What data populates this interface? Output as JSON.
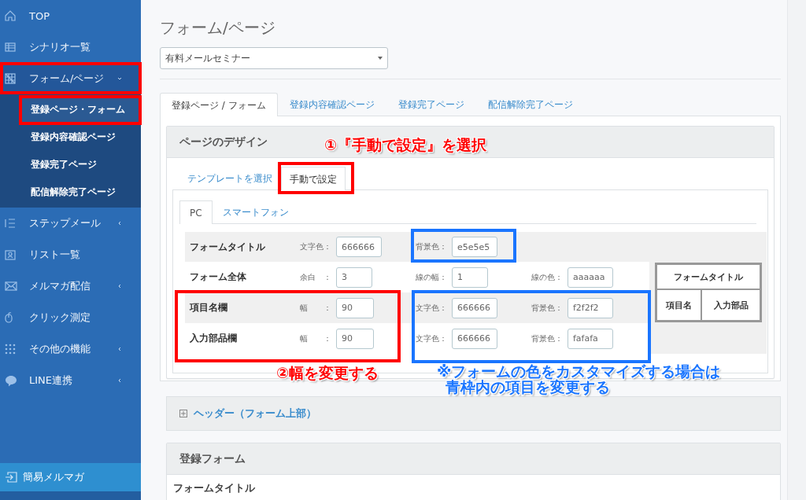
{
  "sidebar": {
    "items": [
      {
        "label": "TOP",
        "kind": "link"
      },
      {
        "label": "シナリオ一覧",
        "kind": "link"
      },
      {
        "label": "フォーム/ページ",
        "kind": "group",
        "expanded": true,
        "children": [
          {
            "label": "登録ページ・フォーム",
            "selected": true
          },
          {
            "label": "登録内容確認ページ",
            "selected": false
          },
          {
            "label": "登録完了ページ",
            "selected": false
          },
          {
            "label": "配信解除完了ページ",
            "selected": false
          }
        ]
      },
      {
        "label": "ステップメール",
        "kind": "group",
        "expanded": false
      },
      {
        "label": "リスト一覧",
        "kind": "link"
      },
      {
        "label": "メルマガ配信",
        "kind": "group",
        "expanded": false
      },
      {
        "label": "クリック測定",
        "kind": "link"
      },
      {
        "label": "その他の機能",
        "kind": "group",
        "expanded": false
      },
      {
        "label": "LINE連携",
        "kind": "group",
        "expanded": false
      }
    ],
    "footer_item": "簡易メルマガ"
  },
  "main": {
    "title": "フォーム/ページ",
    "select": {
      "value": "有料メールセミナー"
    },
    "tabs": [
      {
        "label": "登録ページ / フォーム",
        "selected": true
      },
      {
        "label": "登録内容確認ページ",
        "selected": false
      },
      {
        "label": "登録完了ページ",
        "selected": false
      },
      {
        "label": "配信解除完了ページ",
        "selected": false
      }
    ],
    "design_panel": {
      "title": "ページのデザイン",
      "mode_tabs": [
        {
          "label": "テンプレートを選択",
          "selected": false
        },
        {
          "label": "手動で設定",
          "selected": true
        }
      ],
      "device_tabs": [
        {
          "label": "PC",
          "selected": true
        },
        {
          "label": "スマートフォン",
          "selected": false
        }
      ],
      "rows": [
        {
          "label": "フォームタイトル",
          "fields": [
            {
              "label": "文字色：",
              "value": "666666"
            },
            {
              "label": "背景色：",
              "value": "e5e5e5"
            }
          ]
        },
        {
          "label": "フォーム全体",
          "fields": [
            {
              "label": "余白　：",
              "value": "3"
            },
            {
              "label": "線の幅：",
              "value": "1"
            },
            {
              "label": "線の色：",
              "value": "aaaaaa"
            }
          ]
        },
        {
          "label": "項目名欄",
          "fields": [
            {
              "label": "幅　　：",
              "value": "90"
            },
            {
              "label": "文字色：",
              "value": "666666"
            },
            {
              "label": "背景色：",
              "value": "f2f2f2"
            }
          ]
        },
        {
          "label": "入力部品欄",
          "fields": [
            {
              "label": "幅　　：",
              "value": "90"
            },
            {
              "label": "文字色：",
              "value": "666666"
            },
            {
              "label": "背景色：",
              "value": "fafafa"
            }
          ]
        }
      ],
      "preview": {
        "title_cell": "フォームタイトル",
        "label_cell": "項目名",
        "input_cell": "入力部品"
      }
    },
    "header_panel": {
      "title": "ヘッダー（フォーム上部）",
      "expanded": false
    },
    "form_panel": {
      "title": "登録フォーム",
      "first_field": "フォームタイトル"
    }
  },
  "annotations": {
    "boxes": [
      {
        "color": "#ff0000"
      },
      {
        "color": "#ff0000"
      },
      {
        "color": "#ff0000"
      },
      {
        "color": "#ff0000"
      },
      {
        "color": "#1a75ff"
      },
      {
        "color": "#1a75ff"
      }
    ],
    "notes": [
      {
        "text": "①『手動で設定』を選択",
        "color": "#ff0000"
      },
      {
        "text": "②幅を変更する",
        "color": "#ff0000"
      },
      {
        "text": "※フォームの色をカスタマイズする場合は",
        "color": "#1a75ff"
      },
      {
        "text": "青枠内の項目を変更する",
        "color": "#1a75ff"
      }
    ]
  }
}
